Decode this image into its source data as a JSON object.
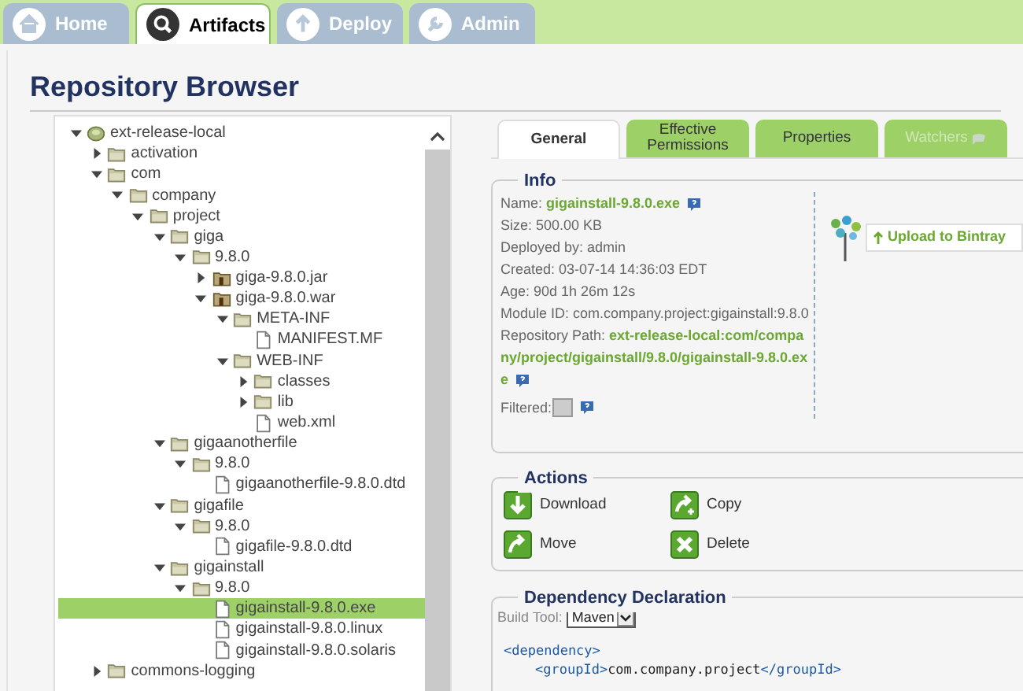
{
  "nav_tabs": [
    {
      "label": "Home",
      "selected": false
    },
    {
      "label": "Artifacts",
      "selected": true
    },
    {
      "label": "Deploy",
      "selected": false
    },
    {
      "label": "Admin",
      "selected": false
    }
  ],
  "page_title": "Repository Browser",
  "tree": [
    {
      "label": "ext-release-local",
      "kind": "repo",
      "expanded": true,
      "selected": false,
      "children": [
        {
          "label": "activation",
          "kind": "folder",
          "expanded": false,
          "selected": false
        },
        {
          "label": "com",
          "kind": "folder",
          "expanded": true,
          "selected": false,
          "children": [
            {
              "label": "company",
              "kind": "folder",
              "expanded": true,
              "selected": false,
              "children": [
                {
                  "label": "project",
                  "kind": "folder",
                  "expanded": true,
                  "selected": false,
                  "children": [
                    {
                      "label": "giga",
                      "kind": "folder",
                      "expanded": true,
                      "selected": false,
                      "children": [
                        {
                          "label": "9.8.0",
                          "kind": "folder",
                          "expanded": true,
                          "selected": false,
                          "children": [
                            {
                              "label": "giga-9.8.0.jar",
                              "kind": "archive",
                              "expanded": false,
                              "selected": false
                            },
                            {
                              "label": "giga-9.8.0.war",
                              "kind": "archive",
                              "expanded": true,
                              "selected": false,
                              "children": [
                                {
                                  "label": "META-INF",
                                  "kind": "folder",
                                  "expanded": true,
                                  "selected": false,
                                  "children": [
                                    {
                                      "label": "MANIFEST.MF",
                                      "kind": "file",
                                      "selected": false
                                    }
                                  ]
                                },
                                {
                                  "label": "WEB-INF",
                                  "kind": "folder",
                                  "expanded": true,
                                  "selected": false,
                                  "children": [
                                    {
                                      "label": "classes",
                                      "kind": "folder",
                                      "expanded": false,
                                      "selected": false
                                    },
                                    {
                                      "label": "lib",
                                      "kind": "folder",
                                      "expanded": false,
                                      "selected": false
                                    },
                                    {
                                      "label": "web.xml",
                                      "kind": "file",
                                      "selected": false
                                    }
                                  ]
                                }
                              ]
                            }
                          ]
                        }
                      ]
                    },
                    {
                      "label": "gigaanotherfile",
                      "kind": "folder",
                      "expanded": true,
                      "selected": false,
                      "children": [
                        {
                          "label": "9.8.0",
                          "kind": "folder",
                          "expanded": true,
                          "selected": false,
                          "children": [
                            {
                              "label": "gigaanotherfile-9.8.0.dtd",
                              "kind": "file",
                              "selected": false
                            }
                          ]
                        }
                      ]
                    },
                    {
                      "label": "gigafile",
                      "kind": "folder",
                      "expanded": true,
                      "selected": false,
                      "children": [
                        {
                          "label": "9.8.0",
                          "kind": "folder",
                          "expanded": true,
                          "selected": false,
                          "children": [
                            {
                              "label": "gigafile-9.8.0.dtd",
                              "kind": "file",
                              "selected": false
                            }
                          ]
                        }
                      ]
                    },
                    {
                      "label": "gigainstall",
                      "kind": "folder",
                      "expanded": true,
                      "selected": false,
                      "children": [
                        {
                          "label": "9.8.0",
                          "kind": "folder",
                          "expanded": true,
                          "selected": false,
                          "children": [
                            {
                              "label": "gigainstall-9.8.0.exe",
                              "kind": "file",
                              "selected": true
                            },
                            {
                              "label": "gigainstall-9.8.0.linux",
                              "kind": "file",
                              "selected": false
                            },
                            {
                              "label": "gigainstall-9.8.0.solaris",
                              "kind": "file",
                              "selected": false
                            }
                          ]
                        }
                      ]
                    }
                  ]
                }
              ]
            }
          ]
        },
        {
          "label": "commons-logging",
          "kind": "folder",
          "expanded": false,
          "selected": false
        }
      ]
    }
  ],
  "detail_tabs": [
    {
      "label": "General",
      "selected": true,
      "disabled": false
    },
    {
      "label": "Effective Permissions",
      "selected": false,
      "disabled": false
    },
    {
      "label": "Properties",
      "selected": false,
      "disabled": false
    },
    {
      "label": "Watchers",
      "selected": false,
      "disabled": true
    }
  ],
  "info": {
    "title": "Info",
    "fields": [
      {
        "label": "Name:",
        "value": "gigainstall-9.8.0.exe",
        "kind": "link",
        "help": true
      },
      {
        "label": "Size:",
        "value": "500.00 KB",
        "kind": "plain"
      },
      {
        "label": "Deployed by:",
        "value": "admin",
        "kind": "plain"
      },
      {
        "label": "Created:",
        "value": "03-07-14 14:36:03 EDT",
        "kind": "plain"
      },
      {
        "label": "Age:",
        "value": "90d 1h 26m 12s",
        "kind": "plain"
      },
      {
        "label": "Module ID:",
        "value": "com.company.project:gigainstall:9.8.0",
        "kind": "plain"
      },
      {
        "label": "Repository Path:",
        "value": "ext-release-local:com/company/project/gigainstall/9.8.0/gigainstall-9.8.0.exe",
        "kind": "link",
        "help": true
      }
    ],
    "filtered": {
      "label": "Filtered:",
      "checked": false
    },
    "upload_button": "Upload to Bintray"
  },
  "actions": {
    "title": "Actions",
    "items": [
      {
        "label": "Download",
        "kind": "download"
      },
      {
        "label": "Copy",
        "kind": "copy"
      },
      {
        "label": "Move",
        "kind": "move"
      },
      {
        "label": "Delete",
        "kind": "delete"
      }
    ]
  },
  "dependency": {
    "title": "Dependency Declaration",
    "build_tool_label": "Build Tool:",
    "build_tool": "Maven",
    "code": [
      [
        {
          "t": "<dependency>",
          "kind": "tag"
        }
      ],
      [
        {
          "t": "<groupId>",
          "kind": "tag"
        },
        {
          "t": "com.company.project",
          "kind": "text"
        },
        {
          "t": "</groupId>",
          "kind": "tag"
        }
      ]
    ]
  }
}
